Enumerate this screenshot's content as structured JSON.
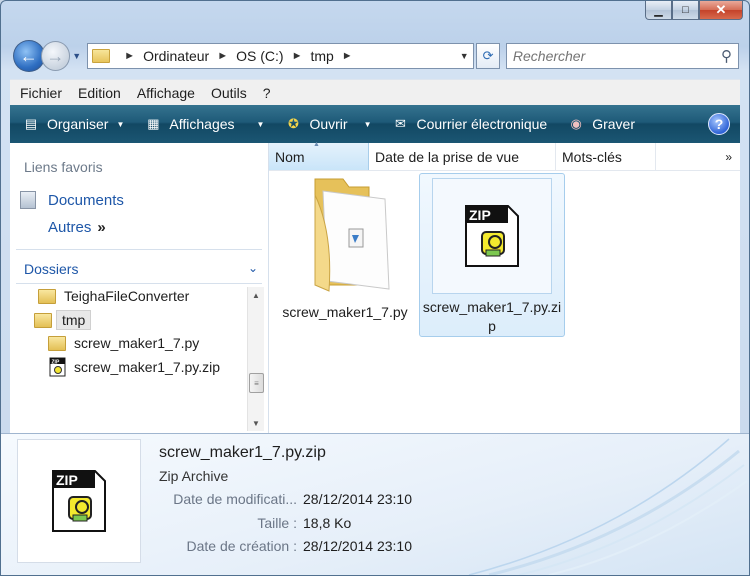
{
  "window": {
    "caption_buttons": [
      "minimize-icon",
      "maximize-icon",
      "close-icon"
    ]
  },
  "nav": {
    "breadcrumb": [
      "Ordinateur",
      "OS (C:)",
      "tmp"
    ],
    "search_placeholder": "Rechercher"
  },
  "menu": [
    "Fichier",
    "Edition",
    "Affichage",
    "Outils",
    "?"
  ],
  "toolbar": {
    "organize": "Organiser",
    "views": "Affichages",
    "open": "Ouvrir",
    "email": "Courrier électronique",
    "burn": "Graver"
  },
  "navpane": {
    "favorites_header": "Liens favoris",
    "documents": "Documents",
    "others": "Autres",
    "folders_header": "Dossiers",
    "tree": [
      "TeighaFileConverter",
      "tmp",
      "screw_maker1_7.py",
      "screw_maker1_7.py.zip"
    ]
  },
  "columns": [
    "Nom",
    "Date de la prise de vue",
    "Mots-clés",
    "»"
  ],
  "files": [
    {
      "name": "screw_maker1_7.py",
      "type": "folder"
    },
    {
      "name_line1": "screw_maker1_7.py.zi",
      "name_line2": "p",
      "type": "zip",
      "selected": true
    }
  ],
  "details": {
    "name": "screw_maker1_7.py.zip",
    "type": "Zip Archive",
    "modified_label": "Date de modificati...",
    "modified_value": "28/12/2014 23:10",
    "size_label": "Taille :",
    "size_value": "18,8 Ko",
    "created_label": "Date de création :",
    "created_value": "28/12/2014 23:10"
  },
  "icon_text": {
    "zip": "ZIP"
  },
  "colors": {
    "accent": "#1e57a8",
    "toolbar": "#1b5673",
    "selection": "#dcedfb"
  }
}
